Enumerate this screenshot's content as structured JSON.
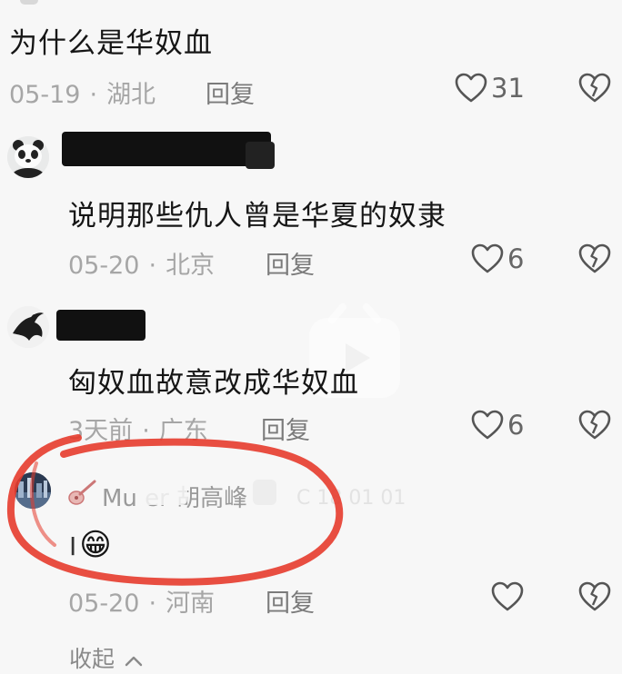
{
  "comments": [
    {
      "text": "为什么是华奴血",
      "date": "05-19",
      "location": "湖北",
      "reply_label": "回复",
      "likes": "31",
      "icons": {
        "like": "heart-outline-icon",
        "dislike": "broken-heart-icon"
      }
    },
    {
      "text": "说明那些仇人曾是华夏的奴隶",
      "date": "05-20",
      "location": "北京",
      "reply_label": "回复",
      "likes": "6",
      "icons": {
        "avatar": "panda-avatar",
        "like": "heart-outline-icon",
        "dislike": "broken-heart-icon"
      }
    },
    {
      "text": "匈奴血故意改成华奴血",
      "date": "3天前",
      "location": "广东",
      "reply_label": "回复",
      "likes": "6",
      "icons": {
        "avatar": "ink-figure-avatar",
        "like": "heart-outline-icon",
        "dislike": "broken-heart-icon"
      }
    },
    {
      "username": "Mu   er  胡高峰",
      "text": "I",
      "emoji": "😁",
      "date": "05-20",
      "location": "河南",
      "reply_label": "回复",
      "icons": {
        "avatar": "photo-avatar",
        "badge": "guitar-icon",
        "like": "heart-outline-icon",
        "dislike": "broken-heart-icon"
      }
    }
  ],
  "separator": "·",
  "collapse_label": "收起",
  "watermark_text": "C  18  01 01",
  "colors": {
    "background": "#f7f7f7",
    "text": "#161616",
    "meta": "#a6a6a6",
    "highlight_circle": "#e53b2c"
  }
}
